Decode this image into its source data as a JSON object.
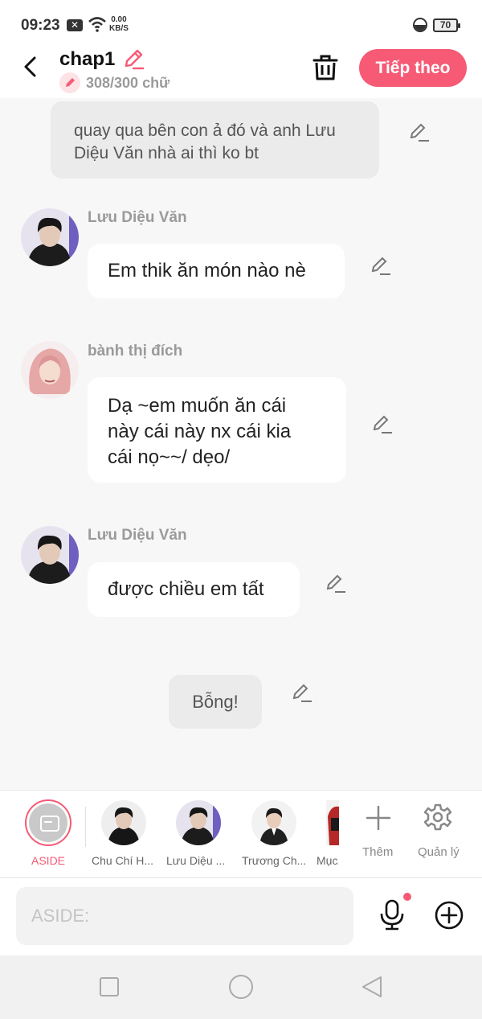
{
  "status_bar": {
    "time": "09:23",
    "net_speed_value": "0.00",
    "net_speed_unit": "KB/S",
    "battery": "70"
  },
  "header": {
    "title": "chap1",
    "word_count": "308/300 chữ",
    "next_button": "Tiếp theo"
  },
  "messages": [
    {
      "type": "aside",
      "text_lines": [
        "quay qua bên con ả đó và anh Lưu",
        "Diệu Văn nhà ai thì ko bt"
      ]
    },
    {
      "type": "chat",
      "speaker": "Lưu Diệu Văn",
      "text_lines": [
        "Em thik ăn món nào nè"
      ]
    },
    {
      "type": "chat",
      "speaker": "bành thị đích",
      "text_lines": [
        "Dạ ~em muốn ăn cái",
        "này cái này nx cái kia",
        "cái nọ~~/ dẹo/"
      ]
    },
    {
      "type": "chat",
      "speaker": "Lưu Diệu Văn",
      "text_lines": [
        "được chiều em tất"
      ]
    },
    {
      "type": "aside",
      "text_lines": [
        "Bỗng!"
      ]
    }
  ],
  "character_bar": {
    "items": [
      {
        "label": "ASIDE"
      },
      {
        "label": "Chu Chí H..."
      },
      {
        "label": "Lưu Diệu ..."
      },
      {
        "label": "Trương Ch..."
      },
      {
        "label": "Mục..."
      }
    ],
    "add_label": "Thêm",
    "manage_label": "Quản lý"
  },
  "input": {
    "placeholder": "ASIDE:"
  },
  "colors": {
    "accent": "#f65a75",
    "background": "#f7f7f7",
    "bubble": "#ffffff",
    "aside_bubble": "#ebebeb"
  },
  "icons": [
    "back-icon",
    "pencil-icon",
    "trash-icon",
    "mic-icon",
    "plus-circle-icon",
    "plus-icon",
    "gear-icon"
  ]
}
